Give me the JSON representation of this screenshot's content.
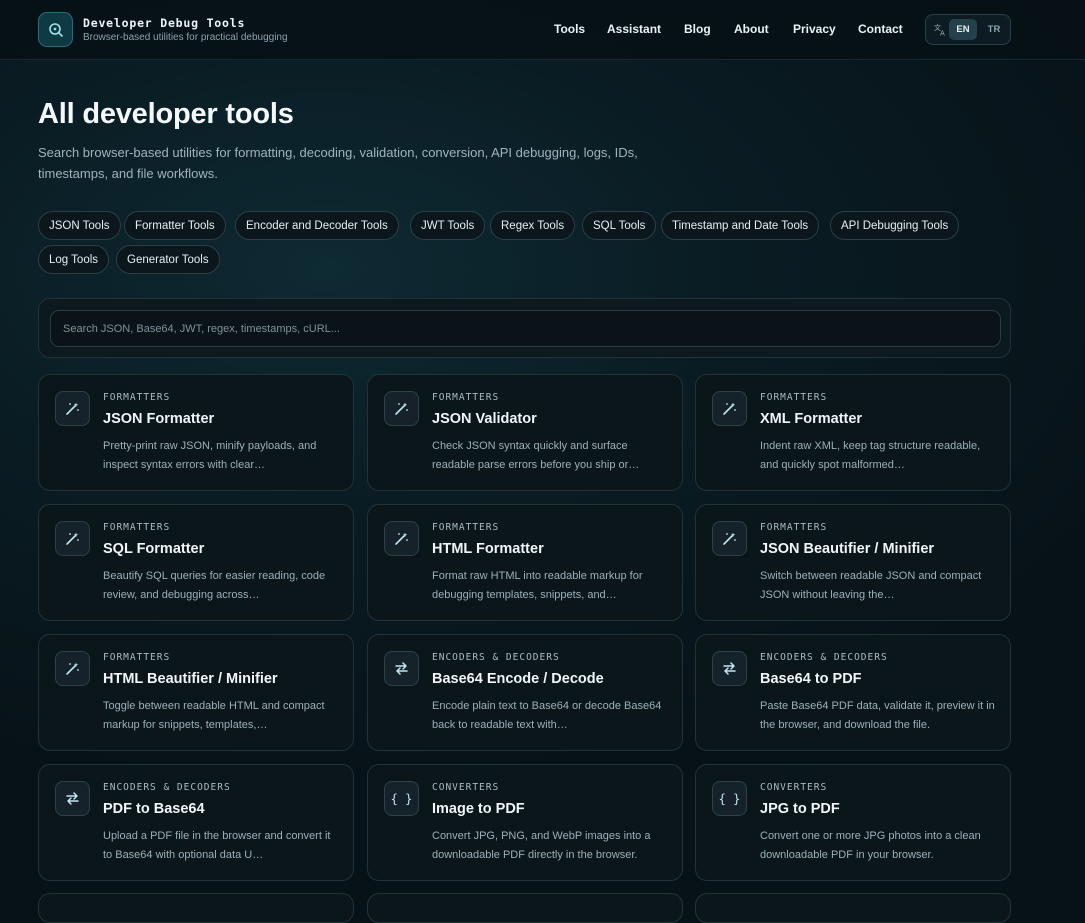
{
  "header": {
    "title": "Developer Debug Tools",
    "subtitle": "Browser-based utilities for practical debugging",
    "logo_icon": "search-code-icon",
    "nav": [
      "Tools",
      "Assistant",
      "Blog",
      "About",
      "Privacy",
      "Contact"
    ],
    "lang": {
      "icon": "translate-icon",
      "active": "EN",
      "other": "TR"
    }
  },
  "main": {
    "title": "All developer tools",
    "description": "Search browser-based utilities for formatting, decoding, validation, conversion, API debugging, logs, IDs, timestamps, and file workflows.",
    "chips": [
      "JSON Tools",
      "Formatter Tools",
      "Encoder and Decoder Tools",
      "JWT Tools",
      "Regex Tools",
      "SQL Tools",
      "Timestamp and Date Tools",
      "API Debugging Tools",
      "Log Tools",
      "Generator Tools"
    ],
    "search": {
      "placeholder": "Search JSON, Base64, JWT, regex, timestamps, cURL..."
    }
  },
  "cards": [
    {
      "category": "FORMATTERS",
      "title": "JSON Formatter",
      "desc": "Pretty-print raw JSON, minify payloads, and inspect syntax errors with clear…",
      "icon": "magic-wand-icon"
    },
    {
      "category": "FORMATTERS",
      "title": "JSON Validator",
      "desc": "Check JSON syntax quickly and surface readable parse errors before you ship or…",
      "icon": "magic-wand-icon"
    },
    {
      "category": "FORMATTERS",
      "title": "XML Formatter",
      "desc": "Indent raw XML, keep tag structure readable, and quickly spot malformed…",
      "icon": "magic-wand-icon"
    },
    {
      "category": "FORMATTERS",
      "title": "SQL Formatter",
      "desc": "Beautify SQL queries for easier reading, code review, and debugging across…",
      "icon": "magic-wand-icon"
    },
    {
      "category": "FORMATTERS",
      "title": "HTML Formatter",
      "desc": "Format raw HTML into readable markup for debugging templates, snippets, and…",
      "icon": "magic-wand-icon"
    },
    {
      "category": "FORMATTERS",
      "title": "JSON Beautifier / Minifier",
      "desc": "Switch between readable JSON and compact JSON without leaving the…",
      "icon": "magic-wand-icon"
    },
    {
      "category": "FORMATTERS",
      "title": "HTML Beautifier / Minifier",
      "desc": "Toggle between readable HTML and compact markup for snippets, templates,…",
      "icon": "magic-wand-icon"
    },
    {
      "category": "ENCODERS & DECODERS",
      "title": "Base64 Encode / Decode",
      "desc": "Encode plain text to Base64 or decode Base64 back to readable text with…",
      "icon": "swap-arrows-icon"
    },
    {
      "category": "ENCODERS & DECODERS",
      "title": "Base64 to PDF",
      "desc": "Paste Base64 PDF data, validate it, preview it in the browser, and download the file.",
      "icon": "swap-arrows-icon"
    },
    {
      "category": "ENCODERS & DECODERS",
      "title": "PDF to Base64",
      "desc": "Upload a PDF file in the browser and convert it to Base64 with optional data U…",
      "icon": "swap-arrows-icon"
    },
    {
      "category": "CONVERTERS",
      "title": "Image to PDF",
      "desc": "Convert JPG, PNG, and WebP images into a downloadable PDF directly in the browser.",
      "icon": "braces-icon"
    },
    {
      "category": "CONVERTERS",
      "title": "JPG to PDF",
      "desc": "Convert one or more JPG photos into a clean downloadable PDF in your browser.",
      "icon": "braces-icon"
    }
  ]
}
